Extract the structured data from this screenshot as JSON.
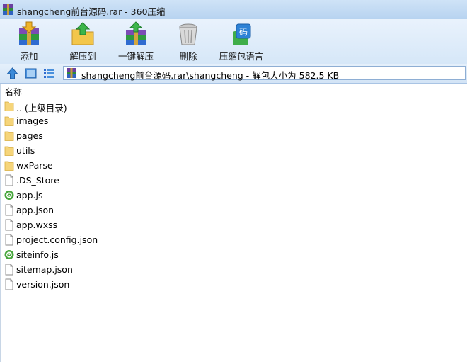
{
  "window": {
    "title": "shangcheng前台源码.rar - 360压缩"
  },
  "toolbar": {
    "buttons": [
      {
        "label": "添加",
        "icon": "add-archive-icon"
      },
      {
        "label": "解压到",
        "icon": "extract-to-icon"
      },
      {
        "label": "一键解压",
        "icon": "one-click-extract-icon"
      },
      {
        "label": "删除",
        "icon": "delete-trash-icon"
      },
      {
        "label": "压缩包语言",
        "icon": "archive-language-icon"
      }
    ]
  },
  "addressbar": {
    "path": "shangcheng前台源码.rar\\shangcheng - 解包大小为 582.5 KB"
  },
  "list": {
    "column_name": "名称",
    "items": [
      {
        "name": ".. (上级目录)",
        "type": "folder"
      },
      {
        "name": "images",
        "type": "folder"
      },
      {
        "name": "pages",
        "type": "folder"
      },
      {
        "name": "utils",
        "type": "folder"
      },
      {
        "name": "wxParse",
        "type": "folder"
      },
      {
        "name": ".DS_Store",
        "type": "file"
      },
      {
        "name": "app.js",
        "type": "js"
      },
      {
        "name": "app.json",
        "type": "file"
      },
      {
        "name": "app.wxss",
        "type": "file"
      },
      {
        "name": "project.config.json",
        "type": "file"
      },
      {
        "name": "siteinfo.js",
        "type": "js"
      },
      {
        "name": "sitemap.json",
        "type": "file"
      },
      {
        "name": "version.json",
        "type": "file"
      }
    ]
  }
}
